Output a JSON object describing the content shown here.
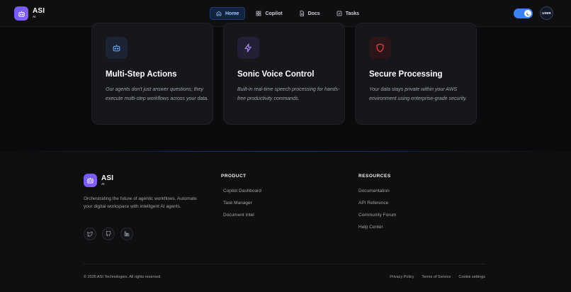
{
  "header": {
    "brand_name": "ASI",
    "brand_sub": "AI",
    "nav": [
      {
        "label": "Home",
        "active": true,
        "icon": "home-icon"
      },
      {
        "label": "Copilot",
        "active": false,
        "icon": "grid-icon"
      },
      {
        "label": "Docs",
        "active": false,
        "icon": "document-icon"
      },
      {
        "label": "Tasks",
        "active": false,
        "icon": "checkbox-icon"
      }
    ],
    "avatar_label": "USER"
  },
  "cards": [
    {
      "title": "Multi-Step Actions",
      "description": "Our agents don't just answer questions; they execute multi-step workflows across your data.",
      "icon": "robot-icon",
      "accent": "#60a5fa"
    },
    {
      "title": "Sonic Voice Control",
      "description": "Built-in real-time speech processing for hands-free productivity commands.",
      "icon": "lightning-icon",
      "accent": "#a78bfa"
    },
    {
      "title": "Secure Processing",
      "description": "Your data stays private within your AWS environment using enterprise-grade security.",
      "icon": "shield-icon",
      "accent": "#ef4444"
    }
  ],
  "footer": {
    "brand_name": "ASI",
    "brand_sub": "AI",
    "description": "Orchestrating the future of agentic workflows. Automate your digital workspace with intelligent AI agents.",
    "socials": [
      "twitter-icon",
      "github-icon",
      "linkedin-icon"
    ],
    "product": {
      "title": "PRODUCT",
      "links": [
        "Copilot Dashboard",
        "Task Manager",
        "Document Intel"
      ]
    },
    "resources": {
      "title": "RESOURCES",
      "links": [
        "Documentation",
        "API Reference",
        "Community Forum",
        "Help Center"
      ]
    },
    "copyright": "© 2026 ASI Technologies. All rights reserved.",
    "legal": [
      "Privacy Policy",
      "Terms of Service",
      "Cookie settings"
    ]
  }
}
